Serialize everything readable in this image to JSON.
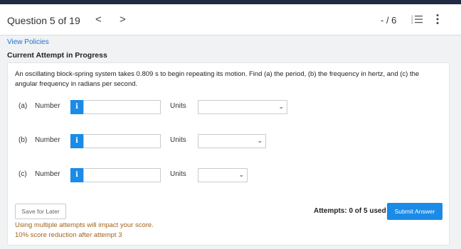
{
  "header": {
    "question_label": "Question 5 of 19",
    "prev_symbol": "<",
    "next_symbol": ">",
    "score": "- / 6"
  },
  "links": {
    "view_policies": "View Policies"
  },
  "attempt_heading": "Current Attempt in Progress",
  "question": {
    "prompt": "An oscillating block-spring system takes 0.809 s to begin repeating its motion. Find (a) the period, (b) the frequency in hertz, and (c) the angular frequency in radians per second."
  },
  "parts": [
    {
      "label": "(a)",
      "number_label": "Number",
      "info": "i",
      "value": "",
      "units_label": "Units",
      "units_value": ""
    },
    {
      "label": "(b)",
      "number_label": "Number",
      "info": "i",
      "value": "",
      "units_label": "Units",
      "units_value": ""
    },
    {
      "label": "(c)",
      "number_label": "Number",
      "info": "i",
      "value": "",
      "units_label": "Units",
      "units_value": ""
    }
  ],
  "footer": {
    "save_label": "Save for Later",
    "attempts": "Attempts: 0 of 5 used",
    "submit_label": "Submit Answer",
    "warning_line1": "Using multiple attempts will impact your score.",
    "warning_line2": "10% score reduction after attempt 3"
  },
  "colors": {
    "accent": "#1a8be6",
    "link": "#1f6fd6",
    "warning": "#a0621b",
    "topbar": "#1f2a44"
  },
  "icons": {
    "list": "list-icon",
    "more": "more-vertical-icon",
    "select": "chevron-down-icon"
  }
}
